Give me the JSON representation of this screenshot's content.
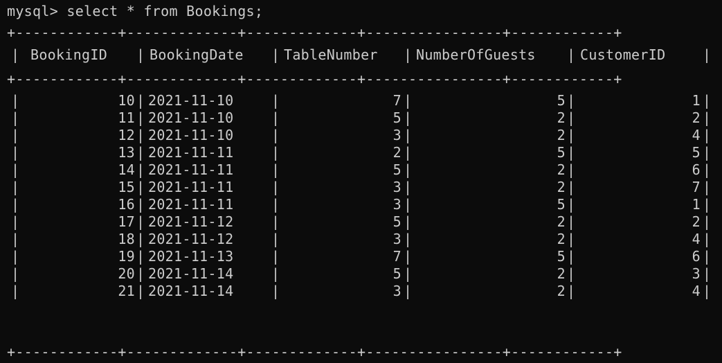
{
  "terminal": {
    "prompt": "mysql> select * from Bookings;",
    "border_line": "+------------+-------------+-------------+----------------+------------+",
    "columns": [
      "BookingID",
      "BookingDate",
      "TableNumber",
      "NumberOfGuests",
      "CustomerID"
    ],
    "rows": [
      [
        "10",
        "2021-11-10",
        "7",
        "5",
        "1"
      ],
      [
        "11",
        "2021-11-10",
        "5",
        "2",
        "2"
      ],
      [
        "12",
        "2021-11-10",
        "3",
        "2",
        "4"
      ],
      [
        "13",
        "2021-11-11",
        "2",
        "5",
        "5"
      ],
      [
        "14",
        "2021-11-11",
        "5",
        "2",
        "6"
      ],
      [
        "15",
        "2021-11-11",
        "3",
        "2",
        "7"
      ],
      [
        "16",
        "2021-11-11",
        "3",
        "5",
        "1"
      ],
      [
        "17",
        "2021-11-12",
        "5",
        "2",
        "2"
      ],
      [
        "18",
        "2021-11-12",
        "3",
        "2",
        "4"
      ],
      [
        "19",
        "2021-11-13",
        "7",
        "5",
        "6"
      ],
      [
        "20",
        "2021-11-14",
        "5",
        "2",
        "3"
      ],
      [
        "21",
        "2021-11-14",
        "3",
        "2",
        "4"
      ]
    ]
  }
}
